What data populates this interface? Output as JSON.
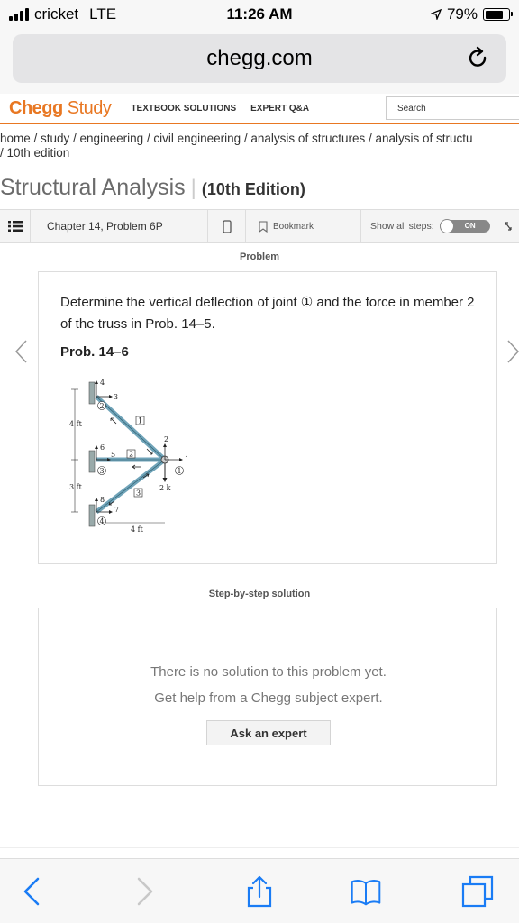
{
  "status": {
    "carrier": "cricket",
    "network": "LTE",
    "time": "11:26 AM",
    "battery": "79%",
    "battery_level": 0.79
  },
  "browser": {
    "url": "chegg.com"
  },
  "nav": {
    "logo_chegg": "Chegg",
    "logo_study": "Study",
    "link_textbook": "TEXTBOOK SOLUTIONS",
    "link_expert": "EXPERT Q&A",
    "search_placeholder": "Search"
  },
  "breadcrumb": {
    "line1": "home / study / engineering / civil engineering / analysis of structures / analysis of structu",
    "line2": "/ 10th edition"
  },
  "book": {
    "title": "Structural Analysis",
    "edition": "(10th Edition)"
  },
  "toolbar": {
    "chapter": "Chapter 14, Problem 6P",
    "bookmark": "Bookmark",
    "show_steps": "Show all steps:",
    "toggle": "ON"
  },
  "problem": {
    "heading": "Problem",
    "text": "Determine the vertical deflection of joint ① and the force in member 2 of the truss in Prob. 14–5.",
    "label": "Prob. 14–6",
    "figure": {
      "dim_4ft_v": "4 ft",
      "dim_3ft": "3 ft",
      "dim_4ft_h": "4 ft",
      "load": "2 k",
      "n4": "4",
      "n3": "3",
      "n2": "2",
      "n1": "1",
      "n6": "6",
      "n5": "5",
      "n8": "8",
      "n7": "7",
      "j1": "1",
      "j2": "2",
      "j3": "3",
      "j4": "4",
      "m1": "1",
      "m2": "2",
      "m3": "3"
    }
  },
  "solution": {
    "heading": "Step-by-step solution",
    "line1": "There is no solution to this problem yet.",
    "line2": "Get help from a Chegg subject expert.",
    "button": "Ask an expert"
  }
}
